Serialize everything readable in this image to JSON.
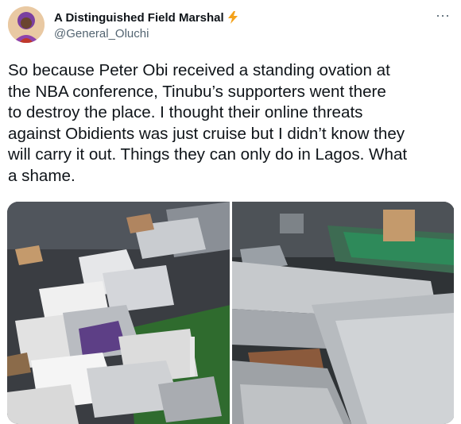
{
  "tweet": {
    "display_name": "A Distinguished Field Marshal",
    "handle": "@General_Oluchi",
    "verified_icon": "lightning-bolt-icon",
    "more_icon": "more-horizontal-icon",
    "more_label": "···",
    "text": "So because Peter Obi received a standing ovation at\nthe NBA conference, Tinubu’s supporters went there\nto destroy the place. I thought their online threats\nagainst Obidients was just cruise but I didn’t know they\nwill carry it out. Things they can only do in Lagos. What\na shame.",
    "media": [
      {
        "icon": "photo-debris-left"
      },
      {
        "icon": "photo-debris-right"
      }
    ]
  },
  "colors": {
    "text": "#0f1419",
    "secondary": "#536471",
    "bolt": "#f4a21b"
  }
}
